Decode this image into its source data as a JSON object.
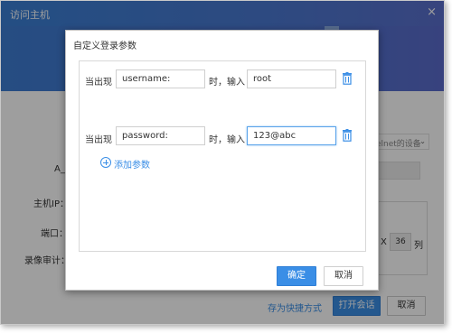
{
  "outer_dialog": {
    "title": "访问主机",
    "close_glyph": "×",
    "labels": {
      "asset": "A_(",
      "host_ip": "主机IP：",
      "port": "端口：",
      "recording": "录像审计："
    },
    "protocol_select_value": "elnet的设备",
    "cols_value": "36",
    "cols_x": "X",
    "cols_unit": "列",
    "shortcut_link": "存为快捷方式",
    "open_session_button": "打开会话",
    "cancel_button": "取消"
  },
  "inner_dialog": {
    "title": "自定义登录参数",
    "rows": [
      {
        "prefix": "当出现",
        "pattern": "username:",
        "middle": "时，输入",
        "value": "root"
      },
      {
        "prefix": "当出现",
        "pattern": "password:",
        "middle": "时，输入",
        "value": "123@abc"
      }
    ],
    "add_param_label": "添加参数",
    "ok_button": "确定",
    "cancel_button": "取消"
  },
  "icons": {
    "trash": "trash-icon",
    "add": "add-circle-icon",
    "dropdown": "chevron-down-icon"
  },
  "colors": {
    "accent": "#3a8ee6",
    "header": "#4a78d0"
  }
}
